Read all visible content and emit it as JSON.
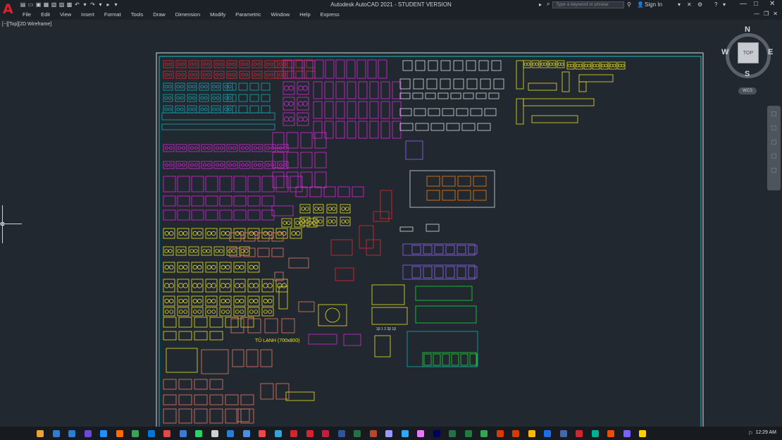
{
  "titlebar": {
    "title": "Autodesk AutoCAD 2021 - STUDENT VERSION",
    "search_placeholder": "Type a keyword or phrase",
    "sign_in": "Sign In"
  },
  "menu": [
    "File",
    "Edit",
    "View",
    "Insert",
    "Format",
    "Tools",
    "Draw",
    "Dimension",
    "Modify",
    "Parametric",
    "Window",
    "Help",
    "Express"
  ],
  "viewport": {
    "label": "[−][Top][2D Wireframe]",
    "fridge_text": "TỦ LẠNH (700x800)",
    "dims_label": "1β 1 2 2β 1β"
  },
  "viewcube": {
    "face": "TOP",
    "n": "N",
    "s": "S",
    "e": "E",
    "w": "W",
    "wcs": "WCS"
  },
  "taskbar": {
    "clock": "12:29 AM"
  },
  "colors": {
    "background": "#212830",
    "sheet_border": "#1cb8c4",
    "block_red": "#e8262c",
    "block_cyan": "#17a6b3",
    "block_magenta": "#d82ad8",
    "block_yellow": "#e8e028",
    "block_salmon": "#e87a6a",
    "block_white": "#d8dce0",
    "block_orange": "#e8801a",
    "block_purple": "#8c64ff",
    "block_green": "#22d83c"
  }
}
